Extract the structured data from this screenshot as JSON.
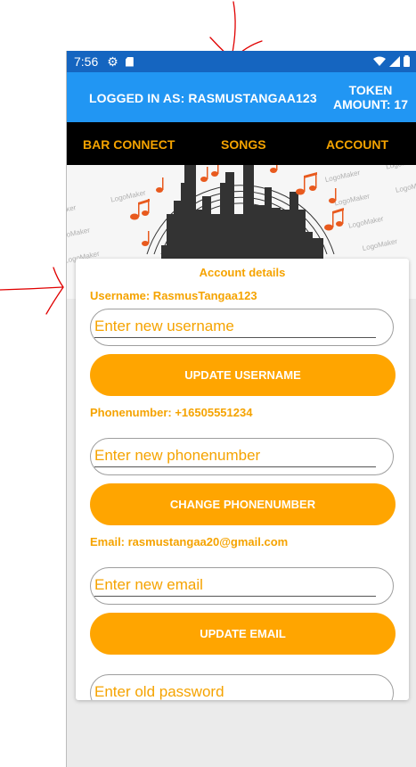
{
  "status_bar": {
    "time": "7:56"
  },
  "header": {
    "logged_in": "LOGGED IN AS:  RASMUSTANGAA123",
    "token_line1": "TOKEN",
    "token_line2": "AMOUNT:  17"
  },
  "nav": {
    "tabs": [
      "BAR CONNECT",
      "SONGS",
      "ACCOUNT"
    ]
  },
  "banner": {
    "watermark": "LogoMaker"
  },
  "account": {
    "title": "Account details",
    "username_label": "Username: RasmusTangaa123",
    "username_placeholder": "Enter new username",
    "username_button": "UPDATE USERNAME",
    "phone_label": "Phonenumber: +16505551234",
    "phone_placeholder": "Enter new phonenumber",
    "phone_button": "CHANGE PHONENUMBER",
    "email_label": "Email: rasmustangaa20@gmail.com",
    "email_placeholder": "Enter new email",
    "email_button": "UPDATE EMAIL",
    "password_placeholder": "Enter old password"
  },
  "colors": {
    "accent": "#ffa500",
    "header": "#2196f3",
    "status_bar": "#1565c0",
    "nav": "#000000",
    "annotation": "#e00000"
  }
}
